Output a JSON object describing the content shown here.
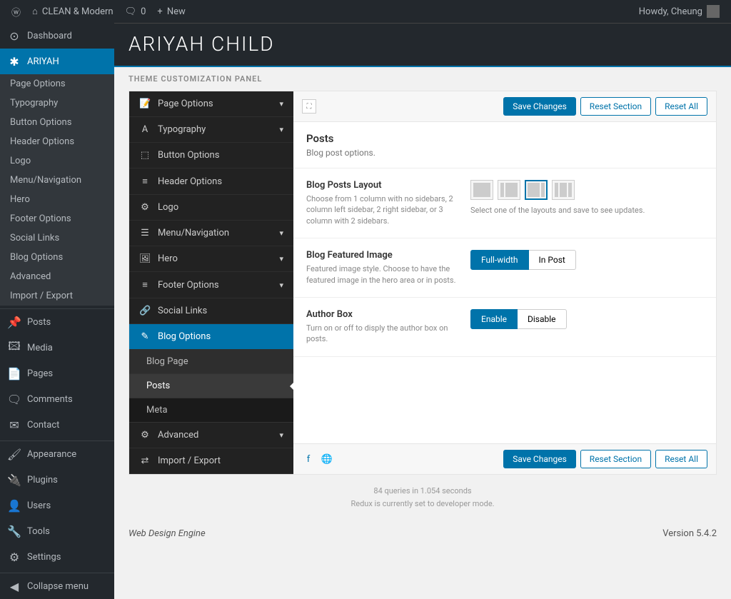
{
  "toolbar": {
    "site_name": "CLEAN & Modern",
    "comment_count": "0",
    "new_label": "New",
    "howdy": "Howdy, Cheung"
  },
  "wp_menu": {
    "dashboard": "Dashboard",
    "ariyah": "ARIYAH",
    "submenu": [
      "Page Options",
      "Typography",
      "Button Options",
      "Header Options",
      "Logo",
      "Menu/Navigation",
      "Hero",
      "Footer Options",
      "Social Links",
      "Blog Options",
      "Advanced",
      "Import / Export"
    ],
    "posts": "Posts",
    "media": "Media",
    "pages": "Pages",
    "comments": "Comments",
    "contact": "Contact",
    "appearance": "Appearance",
    "plugins": "Plugins",
    "users": "Users",
    "tools": "Tools",
    "settings": "Settings",
    "collapse": "Collapse menu"
  },
  "header": {
    "title": "ARIYAH CHILD"
  },
  "panel_label": "THEME CUSTOMIZATION PANEL",
  "opts_menu": [
    {
      "icon": "📝",
      "label": "Page Options",
      "chev": true
    },
    {
      "icon": "A",
      "label": "Typography",
      "chev": true
    },
    {
      "icon": "⬚",
      "label": "Button Options",
      "chev": false
    },
    {
      "icon": "≡",
      "label": "Header Options",
      "chev": false
    },
    {
      "icon": "⚙",
      "label": "Logo",
      "chev": false
    },
    {
      "icon": "☰",
      "label": "Menu/Navigation",
      "chev": true
    },
    {
      "icon": "🖼",
      "label": "Hero",
      "chev": true
    },
    {
      "icon": "≡",
      "label": "Footer Options",
      "chev": true
    },
    {
      "icon": "🔗",
      "label": "Social Links",
      "chev": false
    }
  ],
  "blog_options": {
    "icon": "✎",
    "label": "Blog Options"
  },
  "blog_sub": [
    "Blog Page",
    "Posts",
    "Meta"
  ],
  "opts_menu_tail": [
    {
      "icon": "⚙",
      "label": "Advanced",
      "chev": true
    },
    {
      "icon": "⇄",
      "label": "Import / Export",
      "chev": false
    }
  ],
  "buttons": {
    "save": "Save Changes",
    "reset_section": "Reset Section",
    "reset_all": "Reset All"
  },
  "section": {
    "title": "Posts",
    "desc": "Blog post options."
  },
  "fields": {
    "layout": {
      "title": "Blog Posts Layout",
      "desc": "Choose from 1 column with no sidebars, 2 column left sidebar, 2 right sidebar, or 3 column with 2 sidebars.",
      "hint": "Select one of the layouts and save to see updates."
    },
    "featured": {
      "title": "Blog Featured Image",
      "desc": "Featured image style. Choose to have the featured image in the hero area or in posts.",
      "opt1": "Full-width",
      "opt2": "In Post"
    },
    "author": {
      "title": "Author Box",
      "desc": "Turn on or off to disply the author box on posts.",
      "opt1": "Enable",
      "opt2": "Disable"
    }
  },
  "debug": {
    "line1": "84 queries in 1.054 seconds",
    "line2": "Redux is currently set to developer mode."
  },
  "footer": {
    "left": "Web Design Engine",
    "right": "Version 5.4.2"
  }
}
